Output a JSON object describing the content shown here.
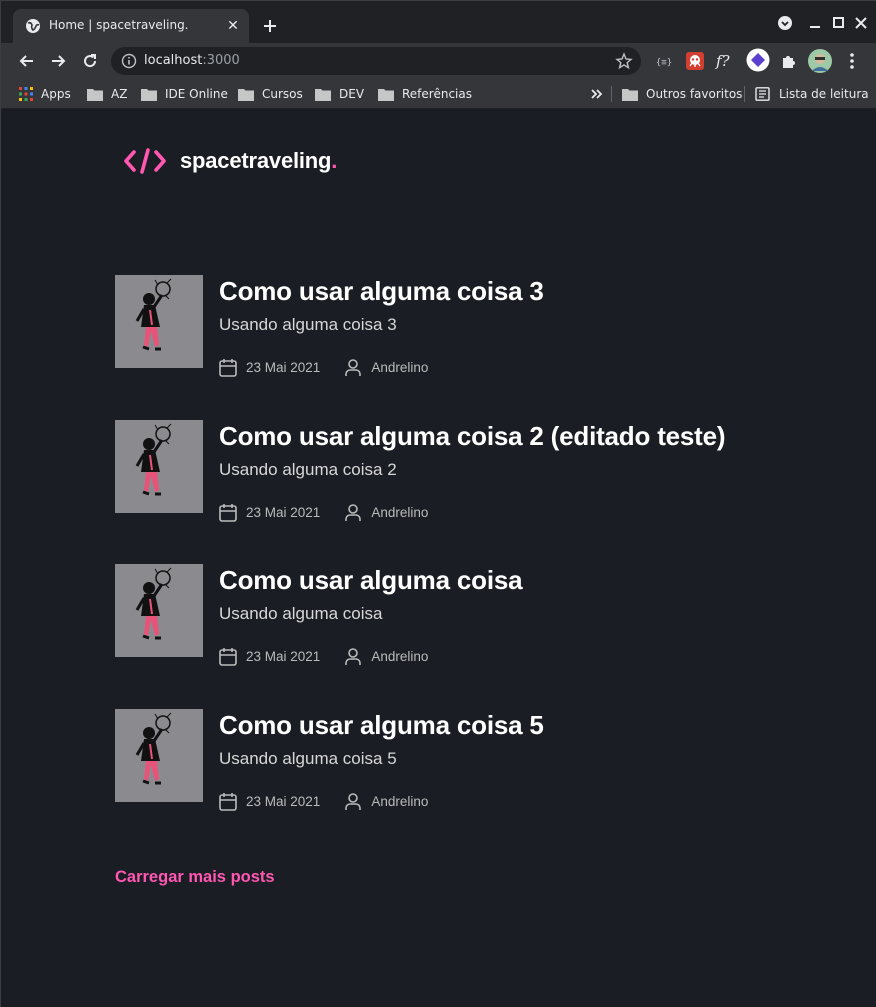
{
  "browser": {
    "tab_title": "Home | spacetraveling.",
    "url_host": "localhost",
    "url_port": ":3000",
    "bookmarks": [
      {
        "label": "Apps",
        "icon": "apps-grid-icon"
      },
      {
        "label": "AZ",
        "icon": "folder-icon"
      },
      {
        "label": "IDE Online",
        "icon": "folder-icon"
      },
      {
        "label": "Cursos",
        "icon": "folder-icon"
      },
      {
        "label": "DEV",
        "icon": "folder-icon"
      },
      {
        "label": "Referências",
        "icon": "folder-icon"
      }
    ],
    "bookmarks_right": [
      {
        "label": "Outros favoritos",
        "icon": "folder-icon"
      },
      {
        "label": "Lista de leitura",
        "icon": "reading-list-icon"
      }
    ],
    "extension_label": "f?",
    "colors": {
      "tabstrip": "#202124",
      "toolbar": "#35363a",
      "omnibox": "#202124"
    }
  },
  "site": {
    "logo_text": "spacetraveling",
    "logo_dot": ".",
    "accent": "#ff57b2",
    "background": "#1a1d23"
  },
  "posts": [
    {
      "title": "Como usar alguma coisa 3",
      "subtitle": "Usando alguma coisa 3",
      "date": "23 Mai 2021",
      "author": "Andrelino"
    },
    {
      "title": "Como usar alguma coisa 2 (editado teste)",
      "subtitle": "Usando alguma coisa 2",
      "date": "23 Mai 2021",
      "author": "Andrelino"
    },
    {
      "title": "Como usar alguma coisa",
      "subtitle": "Usando alguma coisa",
      "date": "23 Mai 2021",
      "author": "Andrelino"
    },
    {
      "title": "Como usar alguma coisa 5",
      "subtitle": "Usando alguma coisa 5",
      "date": "23 Mai 2021",
      "author": "Andrelino"
    }
  ],
  "load_more": "Carregar mais posts"
}
